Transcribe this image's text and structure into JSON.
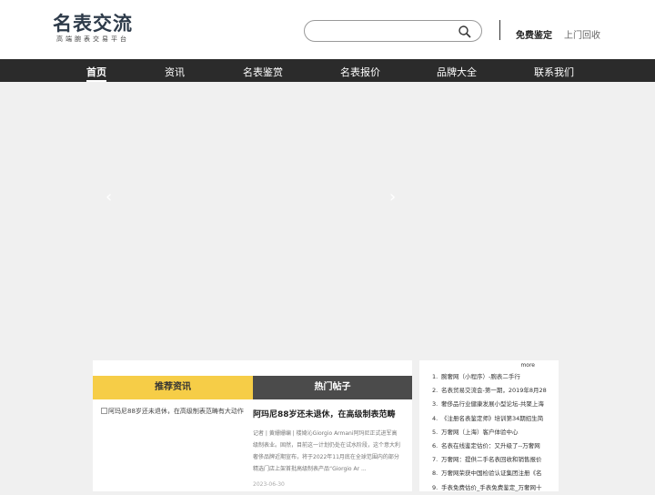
{
  "header": {
    "logo_title": "名表交流",
    "logo_subtitle": "高端腕表交易平台",
    "search_placeholder": "",
    "link_free": "免费鉴定",
    "link_recycle": "上门回收"
  },
  "nav": {
    "items": [
      {
        "label": "首页",
        "active": true
      },
      {
        "label": "资讯"
      },
      {
        "label": "名表鉴赏"
      },
      {
        "label": "名表报价"
      },
      {
        "label": "品牌大全"
      },
      {
        "label": "联系我们"
      }
    ]
  },
  "banner": {
    "prev": "‹",
    "next": "›"
  },
  "tabs": {
    "recommended": "推荐资讯",
    "hot": "热门帖子"
  },
  "article": {
    "image_alt": "阿玛尼88岁还未退休，在高级制表范畴有大动作",
    "title": "阿玛尼88岁还未退休，在高级制表范畴",
    "body": "记者 | 黄姗姗编 | 楼婍沁Giorgio Armani阿玛尼正式进军高级制表业。固然，目前这一计划仍处在试水阶段，这个意大利奢侈品牌近期宣布，将于2022年11月底在全球范围内的部分精选门店上架首批高级制表产品“Giorgio Ar ...",
    "date": "2023-06-30"
  },
  "sidebar": {
    "more": "more",
    "items": [
      "腕奢网（小程序）-腕表二手行",
      "名表贸易交流会-第一期，2019年8月28",
      "奢侈品行业健康发展小型论坛-共聚上海",
      "《注册名表鉴定师》培训第34期招生简",
      "万奢网（上海）客户体验中心",
      "名表在线鉴定估价：又升级了--万奢网",
      "万奢网：提供二手名表回收和销售报价",
      "万奢网荣获中国检验认证集团注册《名",
      "手表免费估价_手表免费鉴定_万奢网十"
    ]
  },
  "colors": {
    "nav_bg": "#2b2b2b",
    "accent": "#f6cd47",
    "tab_dark": "#4b4b4b"
  }
}
